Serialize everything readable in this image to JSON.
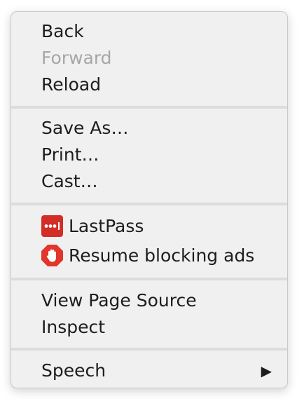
{
  "menu": {
    "items": [
      {
        "label": "Back",
        "enabled": true
      },
      {
        "label": "Forward",
        "enabled": false
      },
      {
        "label": "Reload",
        "enabled": true
      },
      {
        "label": "Save As…",
        "enabled": true
      },
      {
        "label": "Print…",
        "enabled": true
      },
      {
        "label": "Cast…",
        "enabled": true
      },
      {
        "label": "LastPass",
        "icon": "lastpass-icon",
        "enabled": true
      },
      {
        "label": "Resume blocking ads",
        "icon": "adblock-hand-icon",
        "enabled": true
      },
      {
        "label": "View Page Source",
        "enabled": true
      },
      {
        "label": "Inspect",
        "enabled": true
      },
      {
        "label": "Speech",
        "submenu": true,
        "enabled": true
      }
    ],
    "submenu_arrow": "▶"
  },
  "colors": {
    "menu_background": "#f0f0f0",
    "separator": "#dcdcdc",
    "text": "#1d1d1f",
    "disabled_text": "#a7a7a7",
    "lastpass_red": "#d32d27",
    "adblock_red": "#e0362c"
  }
}
